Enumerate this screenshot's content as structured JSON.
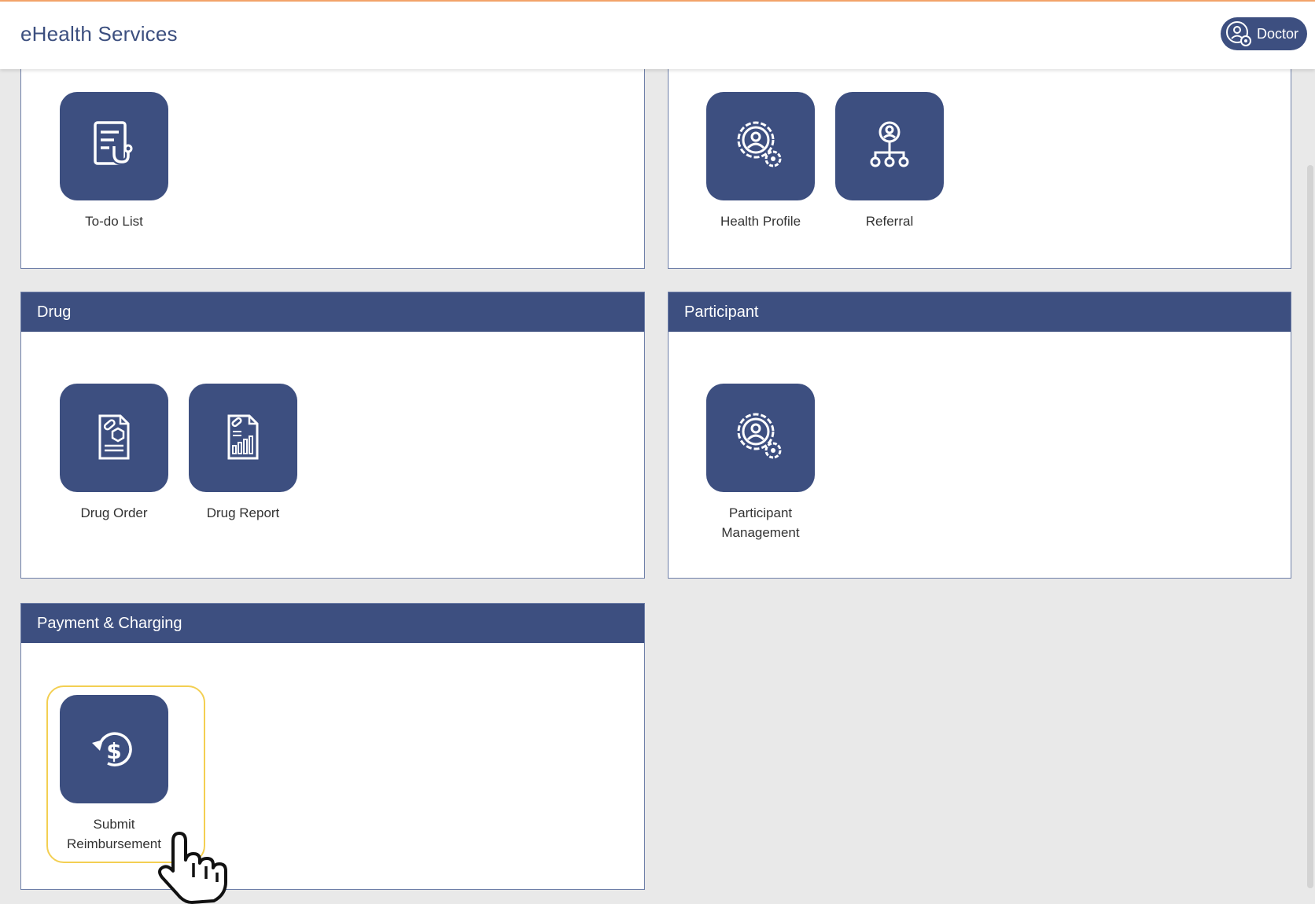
{
  "app": {
    "title": "eHealth Services"
  },
  "user": {
    "role_label": "Doctor",
    "icon": "user-settings-icon"
  },
  "colors": {
    "primary": "#3d4f80",
    "background": "#e9e9e9",
    "selection": "#f3cf52",
    "top_accent": "#f4a46a"
  },
  "sections": [
    {
      "title": "",
      "tiles": [
        {
          "label": "To-do List",
          "icon": "clipboard-stethoscope-icon"
        }
      ]
    },
    {
      "title": "",
      "tiles": [
        {
          "label": "Health Profile",
          "icon": "user-gear-icon"
        },
        {
          "label": "Referral",
          "icon": "referral-network-icon"
        }
      ]
    },
    {
      "title": "Drug",
      "tiles": [
        {
          "label": "Drug Order",
          "icon": "drug-order-document-icon"
        },
        {
          "label": "Drug Report",
          "icon": "drug-report-chart-icon"
        }
      ]
    },
    {
      "title": "Participant",
      "tiles": [
        {
          "label": "Participant Management",
          "icon": "user-gear-icon"
        }
      ]
    },
    {
      "title": "Payment & Charging",
      "tiles": [
        {
          "label": "Submit Reimbursement",
          "icon": "dollar-refund-icon",
          "selected": true
        }
      ]
    }
  ]
}
